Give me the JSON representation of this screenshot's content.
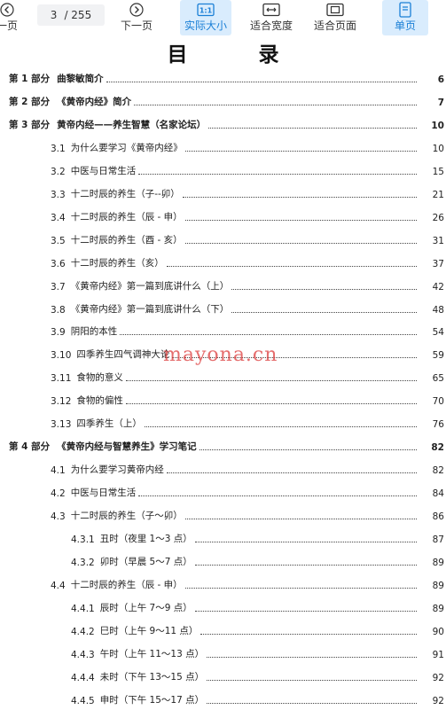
{
  "toolbar": {
    "prev_label": "一页",
    "current_page": "3",
    "total_pages": "/ 255",
    "next_label": "下一页",
    "actual_size_label": "实际大小",
    "actual_size_icon_text": "1:1",
    "fit_width_label": "适合宽度",
    "fit_page_label": "适合页面",
    "single_page_label": "单页",
    "accent": "#1a7fd6"
  },
  "document": {
    "title": "目 录",
    "watermark": "mayona.cn",
    "entries": [
      {
        "level": 1,
        "num": "第 1 部分",
        "title": "曲黎敏简介",
        "page": "6"
      },
      {
        "level": 1,
        "num": "第 2 部分",
        "title": "《黄帝内经》简介",
        "page": "7"
      },
      {
        "level": 1,
        "num": "第 3 部分",
        "title": "黄帝内经——养生智慧（名家论坛）",
        "page": "10"
      },
      {
        "level": 2,
        "num": "3.1",
        "title": "为什么要学习《黄帝内经》",
        "page": "10"
      },
      {
        "level": 2,
        "num": "3.2",
        "title": "中医与日常生活",
        "page": "15"
      },
      {
        "level": 2,
        "num": "3.3",
        "title": "十二时辰的养生（子--卯）",
        "page": "21"
      },
      {
        "level": 2,
        "num": "3.4",
        "title": "十二时辰的养生（辰 - 申）",
        "page": "26"
      },
      {
        "level": 2,
        "num": "3.5",
        "title": "十二时辰的养生（酉 - 亥）",
        "page": "31"
      },
      {
        "level": 2,
        "num": "3.6",
        "title": "十二时辰的养生（亥）",
        "page": "37"
      },
      {
        "level": 2,
        "num": "3.7",
        "title": "《黄帝内经》第一篇到底讲什么（上）",
        "page": "42"
      },
      {
        "level": 2,
        "num": "3.8",
        "title": "《黄帝内经》第一篇到底讲什么（下）",
        "page": "48"
      },
      {
        "level": 2,
        "num": "3.9",
        "title": "阴阳的本性",
        "page": "54"
      },
      {
        "level": 2,
        "num": "3.10",
        "title": "四季养生四气调神大论",
        "page": "59"
      },
      {
        "level": 2,
        "num": "3.11",
        "title": "食物的意义",
        "page": "65"
      },
      {
        "level": 2,
        "num": "3.12",
        "title": "食物的偏性",
        "page": "70"
      },
      {
        "level": 2,
        "num": "3.13",
        "title": "四季养生（上）",
        "page": "76"
      },
      {
        "level": 1,
        "num": "第 4 部分",
        "title": "《黄帝内经与智慧养生》学习笔记",
        "page": "82"
      },
      {
        "level": 2,
        "num": "4.1",
        "title": "为什么要学习黄帝内经",
        "page": "82"
      },
      {
        "level": 2,
        "num": "4.2",
        "title": "中医与日常生活",
        "page": "84"
      },
      {
        "level": 2,
        "num": "4.3",
        "title": "十二时辰的养生（子～卯）",
        "page": "86"
      },
      {
        "level": 3,
        "num": "4.3.1",
        "title": "丑时（夜里 1～3 点）",
        "page": "87"
      },
      {
        "level": 3,
        "num": "4.3.2",
        "title": "卯时（早晨 5～7 点）",
        "page": "89"
      },
      {
        "level": 2,
        "num": "4.4",
        "title": "十二时辰的养生（辰 - 申）",
        "page": "89"
      },
      {
        "level": 3,
        "num": "4.4.1",
        "title": "辰时（上午 7～9 点）",
        "page": "89"
      },
      {
        "level": 3,
        "num": "4.4.2",
        "title": "巳时（上午 9～11 点）",
        "page": "90"
      },
      {
        "level": 3,
        "num": "4.4.3",
        "title": "午时（上午 11～13 点）",
        "page": "91"
      },
      {
        "level": 3,
        "num": "4.4.4",
        "title": "未时（下午 13～15 点）",
        "page": "92"
      },
      {
        "level": 3,
        "num": "4.4.5",
        "title": "申时（下午 15～17 点）",
        "page": "92"
      }
    ]
  }
}
